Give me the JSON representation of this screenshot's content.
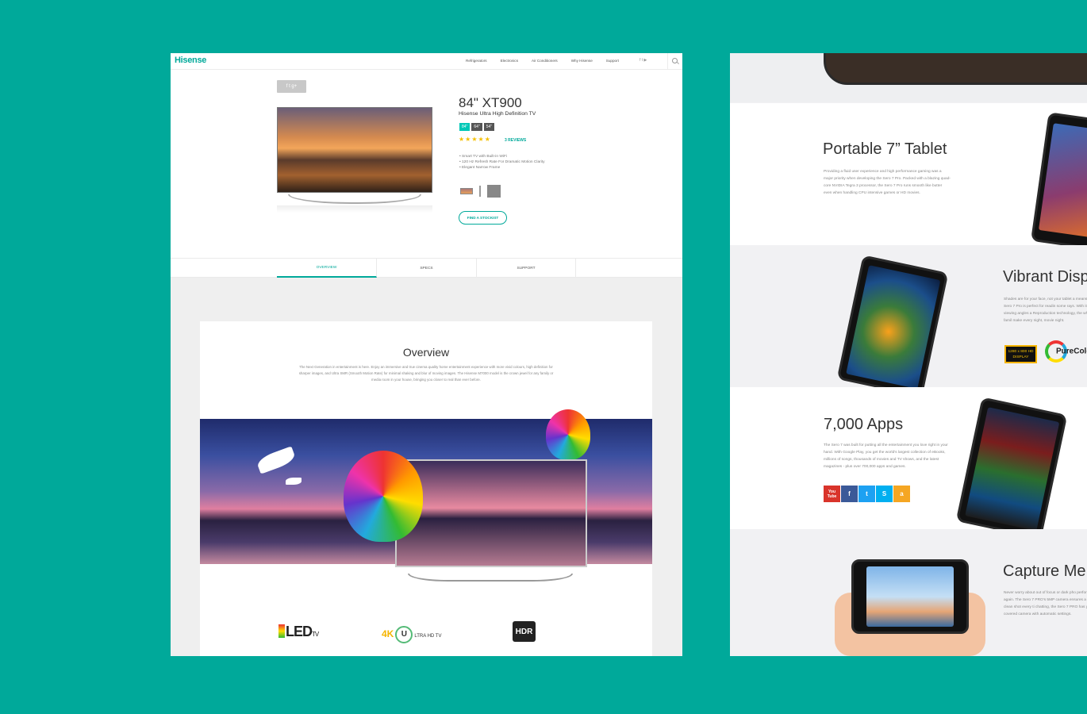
{
  "nav": {
    "logo": "Hisense",
    "links": [
      "Refrigerators",
      "Electronics",
      "Air Conditioners",
      "Why Hisense",
      "Support"
    ],
    "social_icons": "f t ▶"
  },
  "product": {
    "share": "f t g+",
    "title": "84\" XT900",
    "subtitle": "Hisense Ultra High Definition TV",
    "sizes": [
      "84\"",
      "64\"",
      "54\""
    ],
    "stars": "★★★★★",
    "rating": 5,
    "reviews": "3 REVIEWS",
    "features": [
      "• Smart TV with Built-in WiFi",
      "• 120 Hz Refresh Rate For Dramatic Motion Clarity",
      "• Elegant Narrow Frame"
    ],
    "stockist_label": "FIND A STOCKIST"
  },
  "tabs": [
    "OVERVIEW",
    "SPECS",
    "SUPPORT"
  ],
  "overview": {
    "title": "Overview",
    "text": "The Next Generation in entertainment is here. Enjoy an immersive and true cinema quality home entertainment experience with more vivid colours, high definition for sharper images, and Ultra SMR (Smooth Motion Rate) for minimal shaking and blur of moving images. The Hisense M7000 model is the crown jewel for any family or media room in your house, bringing you closer to real than ever before.",
    "logos": {
      "led": "LED",
      "led_tv": "TV",
      "uhd_4k": "4K",
      "uhd_u": "U",
      "uhd_rest": "LTRA HD TV",
      "hdr": "HDR"
    }
  },
  "features_right": [
    {
      "title": "Portable 7” Tablet",
      "text": "Providing a fluid user experience and high performance gaming was a major priority when developing the Sero 7 Pro. Packed with a blazing quad-core NVIDIA Tegra 3 processor, the Sero 7 Pro runs smooth like butter even when handling CPU intensive games or HD movies."
    },
    {
      "title": "Vibrant Disp",
      "text": "Shades are for your face, not your tablet a means the Sero 7 Pro is perfect for readin some rays. With it's wide viewing angles a Reproduction technology, the whole famil make every night, movie night."
    },
    {
      "title": "7,000 Apps",
      "text": "The Sero 7 was built for putting all the entertainment you love right in your hand. With Google Play, you get the world's largest collection of eBooks, millions of songs, thousands of movies and TV shows, and the latest magazines - plus over 700,000 apps and games."
    },
    {
      "title": "Capture Me",
      "text": "Never worry about out of focus or dark pho performance again. The Sero 7 PRO's 5MP camera ensures a crisp, clean shot every ti chatting, the Sero 7 PRO has you covered camera with automatic settings."
    }
  ],
  "badges": {
    "hd_display": "1280 x 800 HD DISPLAY",
    "purecolor": "PureColor"
  },
  "app_icons": [
    "You Tube",
    "f",
    "t",
    "S",
    "a"
  ],
  "colors": {
    "background": "#00a99a",
    "accent": "#00a99a",
    "size_active": "#00c8b7",
    "star": "#f5c000"
  }
}
